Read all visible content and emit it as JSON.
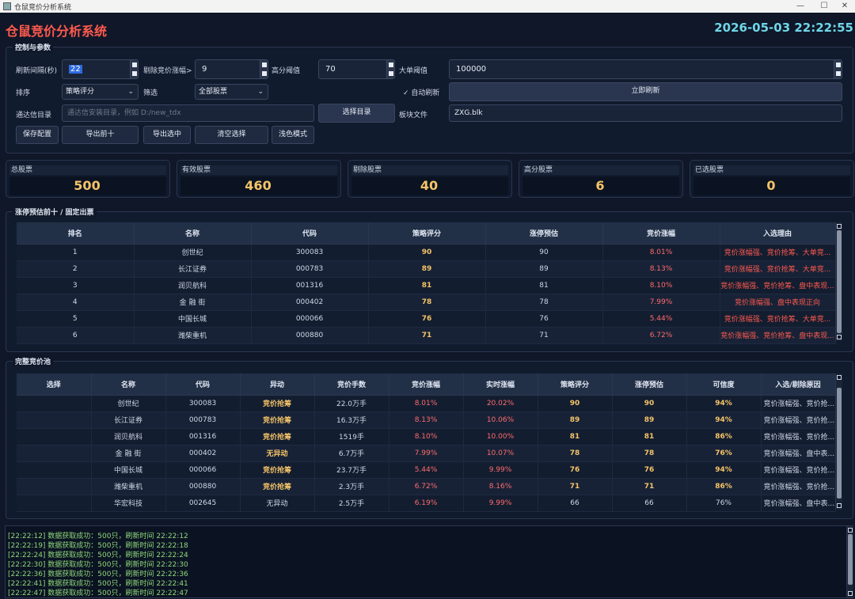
{
  "window": {
    "title": "仓鼠竞价分析系统"
  },
  "header": {
    "title": "仓鼠竞价分析系统",
    "clock": "2026-05-03 22:22:55"
  },
  "controls": {
    "group_title": "控制与参数",
    "refresh_label": "刷新间隔(秒)",
    "refresh_value": "22",
    "exclude_label": "剔除竞价涨幅>",
    "exclude_value": "9",
    "high_label": "高分阈值",
    "high_value": "70",
    "big_label": "大单阈值",
    "big_value": "100000",
    "sort_label": "排序",
    "sort_value": "策略评分",
    "filter_label": "筛选",
    "filter_value": "全部股票",
    "auto_check": "✓",
    "auto_label": "自动刷新",
    "refresh_now": "立即刷新",
    "tdx_label": "通达信目录",
    "tdx_placeholder": "通达信安装目录，例如 D:/new_tdx",
    "choose_dir": "选择目录",
    "block_label": "板块文件",
    "block_value": "ZXG.blk",
    "buttons": [
      "保存配置",
      "导出前十",
      "导出选中",
      "清空选择",
      "浅色模式"
    ]
  },
  "stats": [
    {
      "label": "总股票",
      "value": "500"
    },
    {
      "label": "有效股票",
      "value": "460"
    },
    {
      "label": "剔除股票",
      "value": "40"
    },
    {
      "label": "高分股票",
      "value": "6"
    },
    {
      "label": "已选股票",
      "value": "0"
    }
  ],
  "top10": {
    "group_title": "涨停预估前十 / 固定出票",
    "headers": [
      "排名",
      "名称",
      "代码",
      "策略评分",
      "涨停预估",
      "竞价涨幅",
      "入选理由"
    ],
    "rows": [
      [
        "1",
        "创世纪",
        "300083",
        "90",
        "90",
        "8.01%",
        "竞价涨幅强、竞价抢筹、大单竞..."
      ],
      [
        "2",
        "长江证券",
        "000783",
        "89",
        "89",
        "8.13%",
        "竞价涨幅强、竞价抢筹、大单竞..."
      ],
      [
        "3",
        "润贝航科",
        "001316",
        "81",
        "81",
        "8.10%",
        "竞价涨幅强、竞价抢筹、盘中表现..."
      ],
      [
        "4",
        "金 融 街",
        "000402",
        "78",
        "78",
        "7.99%",
        "竞价涨幅强、盘中表现正向"
      ],
      [
        "5",
        "中国长城",
        "000066",
        "76",
        "76",
        "5.44%",
        "竞价涨幅强、竞价抢筹、大单竞..."
      ],
      [
        "6",
        "潍柴重机",
        "000880",
        "71",
        "71",
        "6.72%",
        "竞价涨幅强、竞价抢筹、盘中表现..."
      ]
    ]
  },
  "pool": {
    "group_title": "完整竞价池",
    "headers": [
      "选择",
      "名称",
      "代码",
      "异动",
      "竞价手数",
      "竞价涨幅",
      "实时涨幅",
      "策略评分",
      "涨停预估",
      "可信度",
      "入选/剔除原因"
    ],
    "rows": [
      [
        "",
        "创世纪",
        "300083",
        "竞价抢筹",
        "22.0万手",
        "8.01%",
        "20.02%",
        "90",
        "90",
        "94%",
        "竞价涨幅强、竞价抢..."
      ],
      [
        "",
        "长江证券",
        "000783",
        "竞价抢筹",
        "16.3万手",
        "8.13%",
        "10.06%",
        "89",
        "89",
        "94%",
        "竞价涨幅强、竞价抢..."
      ],
      [
        "",
        "润贝航科",
        "001316",
        "竞价抢筹",
        "1519手",
        "8.10%",
        "10.00%",
        "81",
        "81",
        "86%",
        "竞价涨幅强、竞价抢..."
      ],
      [
        "",
        "金 融 街",
        "000402",
        "无异动",
        "6.7万手",
        "7.99%",
        "10.07%",
        "78",
        "78",
        "76%",
        "竞价涨幅强、盘中表..."
      ],
      [
        "",
        "中国长城",
        "000066",
        "竞价抢筹",
        "23.7万手",
        "5.44%",
        "9.99%",
        "76",
        "76",
        "94%",
        "竞价涨幅强、竞价抢..."
      ],
      [
        "",
        "潍柴重机",
        "000880",
        "竞价抢筹",
        "2.3万手",
        "6.72%",
        "8.16%",
        "71",
        "71",
        "86%",
        "竞价涨幅强、竞价抢..."
      ],
      [
        "",
        "华宏科技",
        "002645",
        "无异动",
        "2.5万手",
        "6.19%",
        "9.99%",
        "66",
        "66",
        "76%",
        "竞价涨幅强、盘中表..."
      ]
    ]
  },
  "log": [
    "[22:22:12] 数据获取成功：500只，刷新时间 22:22:12",
    "[22:22:19] 数据获取成功：500只，刷新时间 22:22:18",
    "[22:22:24] 数据获取成功：500只，刷新时间 22:22:24",
    "[22:22:30] 数据获取成功：500只，刷新时间 22:22:30",
    "[22:22:36] 数据获取成功：500只，刷新时间 22:22:36",
    "[22:22:41] 数据获取成功：500只，刷新时间 22:22:41",
    "[22:22:47] 数据获取成功：500只，刷新时间 22:22:47"
  ]
}
